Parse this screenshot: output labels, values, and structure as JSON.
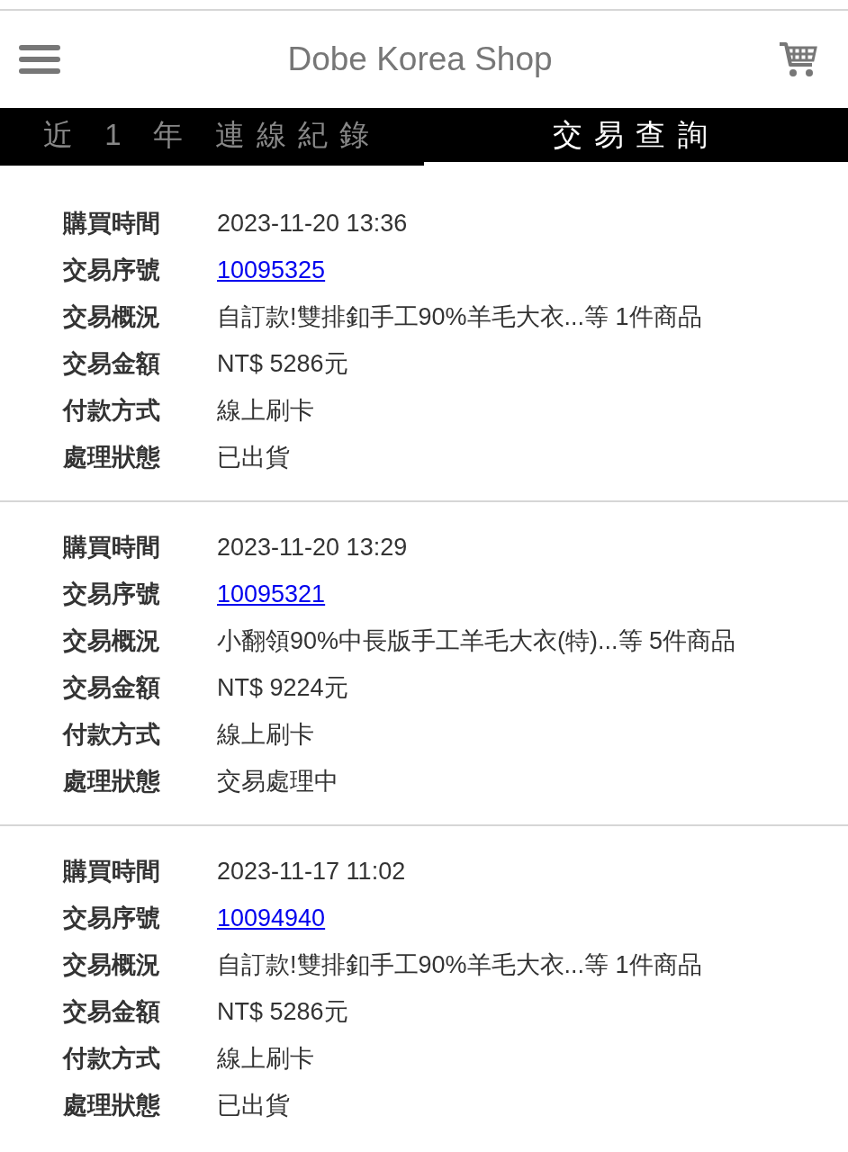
{
  "header": {
    "title": "Dobe Korea Shop"
  },
  "tabs": [
    {
      "label": "近 1 年 連線紀錄",
      "selected": false
    },
    {
      "label": "交易查詢",
      "selected": true
    }
  ],
  "orders": [
    {
      "fields": [
        {
          "label": "購買時間",
          "value": "2023-11-20 13:36",
          "kind": "text"
        },
        {
          "label": "交易序號",
          "value": "10095325",
          "kind": "link"
        },
        {
          "label": "交易概況",
          "value": "自訂款!雙排釦手工90%羊毛大衣...等 1件商品",
          "kind": "text"
        },
        {
          "label": "交易金額",
          "value": "NT$ 5286元",
          "kind": "text"
        },
        {
          "label": "付款方式",
          "value": "線上刷卡",
          "kind": "text"
        },
        {
          "label": "處理狀態",
          "value": "已出貨",
          "kind": "text"
        }
      ]
    },
    {
      "fields": [
        {
          "label": "購買時間",
          "value": "2023-11-20 13:29",
          "kind": "text"
        },
        {
          "label": "交易序號",
          "value": "10095321",
          "kind": "link"
        },
        {
          "label": "交易概況",
          "value": "小翻領90%中長版手工羊毛大衣(特)...等 5件商品",
          "kind": "text"
        },
        {
          "label": "交易金額",
          "value": "NT$ 9224元",
          "kind": "text"
        },
        {
          "label": "付款方式",
          "value": "線上刷卡",
          "kind": "text"
        },
        {
          "label": "處理狀態",
          "value": "交易處理中",
          "kind": "text"
        }
      ]
    },
    {
      "fields": [
        {
          "label": "購買時間",
          "value": "2023-11-17 11:02",
          "kind": "text"
        },
        {
          "label": "交易序號",
          "value": "10094940",
          "kind": "link"
        },
        {
          "label": "交易概況",
          "value": "自訂款!雙排釦手工90%羊毛大衣...等 1件商品",
          "kind": "text"
        },
        {
          "label": "交易金額",
          "value": "NT$ 5286元",
          "kind": "text"
        },
        {
          "label": "付款方式",
          "value": "線上刷卡",
          "kind": "text"
        },
        {
          "label": "處理狀態",
          "value": "已出貨",
          "kind": "text"
        }
      ]
    }
  ]
}
